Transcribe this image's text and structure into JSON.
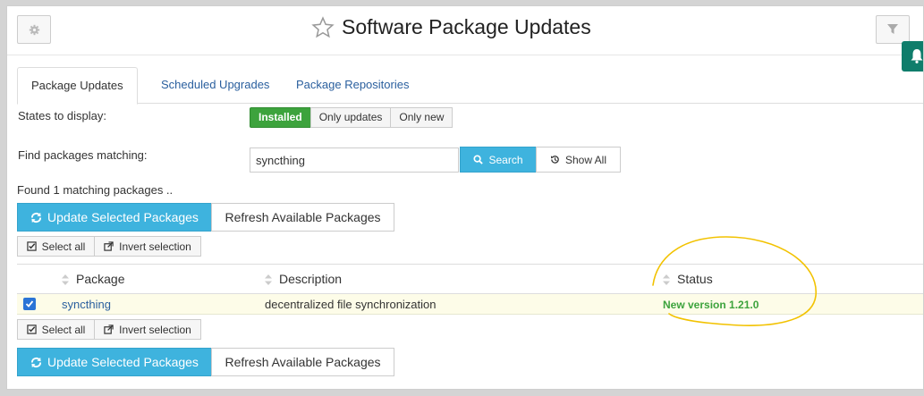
{
  "header": {
    "title": "Software Package Updates",
    "settings_icon": "gear-icon",
    "favorite_icon": "star-icon",
    "filter_icon": "filter-icon",
    "notification_icon": "bell-icon"
  },
  "tabs": [
    {
      "label": "Package Updates",
      "active": true
    },
    {
      "label": "Scheduled Upgrades",
      "active": false
    },
    {
      "label": "Package Repositories",
      "active": false
    }
  ],
  "states": {
    "label": "States to display:",
    "options": [
      "Installed",
      "Only updates",
      "Only new"
    ],
    "selected": "Installed"
  },
  "find": {
    "label": "Find packages matching:",
    "value": "syncthing",
    "search_label": "Search",
    "show_all_label": "Show All"
  },
  "results": {
    "summary": "Found 1 matching packages .."
  },
  "actions": {
    "update_label": "Update Selected Packages",
    "refresh_label": "Refresh Available Packages",
    "select_all_label": "Select all",
    "invert_label": "Invert selection"
  },
  "table": {
    "columns": [
      "Package",
      "Description",
      "Status"
    ],
    "rows": [
      {
        "checked": true,
        "package": "syncthing",
        "description": "decentralized file synchronization",
        "status": "New version 1.21.0"
      }
    ]
  },
  "colors": {
    "accent_blue": "#3eb3de",
    "installed_green": "#3da33d",
    "annotation_yellow": "#f2c200",
    "row_highlight": "#fdfce8"
  }
}
